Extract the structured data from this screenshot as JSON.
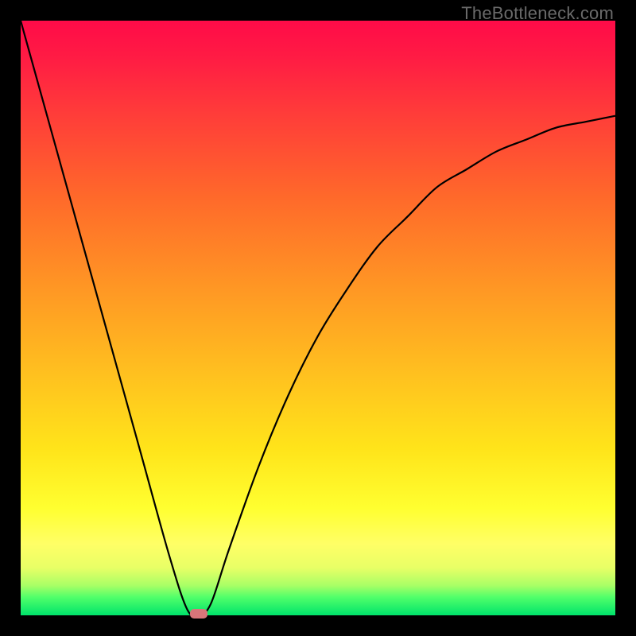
{
  "watermark": "TheBottleneck.com",
  "chart_data": {
    "type": "line",
    "title": "",
    "xlabel": "",
    "ylabel": "",
    "xlim": [
      0,
      100
    ],
    "ylim": [
      0,
      100
    ],
    "grid": false,
    "legend": false,
    "series": [
      {
        "name": "bottleneck-curve",
        "x": [
          0,
          5,
          10,
          15,
          20,
          25,
          28,
          30,
          32,
          35,
          40,
          45,
          50,
          55,
          60,
          65,
          70,
          75,
          80,
          85,
          90,
          95,
          100
        ],
        "values": [
          100,
          82,
          64,
          46,
          28,
          10,
          1,
          0,
          2,
          11,
          25,
          37,
          47,
          55,
          62,
          67,
          72,
          75,
          78,
          80,
          82,
          83,
          84
        ]
      }
    ],
    "marker": {
      "x": 30,
      "y": 0,
      "color": "#d9757a"
    },
    "background_gradient_stops": [
      {
        "pos": 0,
        "color": "#ff0b48"
      },
      {
        "pos": 50,
        "color": "#ffb322"
      },
      {
        "pos": 82,
        "color": "#ffff30"
      },
      {
        "pos": 100,
        "color": "#00e36b"
      }
    ]
  }
}
